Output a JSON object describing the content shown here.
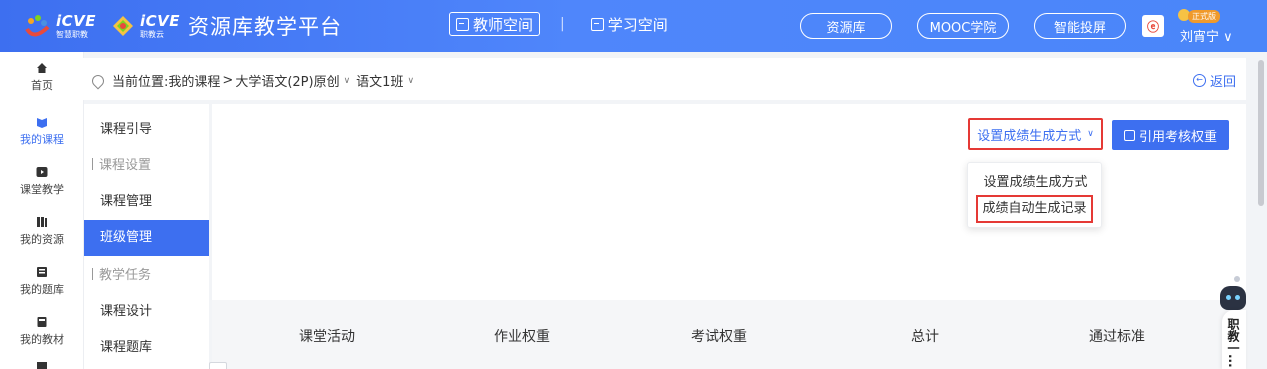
{
  "header": {
    "brand_primary": "iCVE",
    "brand_primary_sub": "智慧职教",
    "brand_secondary": "iCVE",
    "brand_secondary_sub": "职教云",
    "platform_name": "资源库教学平台",
    "tabs": [
      {
        "label": "教师空间",
        "active": true
      },
      {
        "label": "学习空间",
        "active": false
      }
    ],
    "separator": "|",
    "pills": [
      "资源库",
      "MOOC学院",
      "智能投屏"
    ],
    "user": {
      "badge": "正式版",
      "name": "刘宵宁 ∨"
    },
    "accent_color": "#3d6ff0"
  },
  "rail": {
    "items": [
      {
        "label": "首页",
        "icon": "home-icon",
        "active": false
      },
      {
        "label": "我的课程",
        "icon": "course-icon",
        "active": true
      },
      {
        "label": "课堂教学",
        "icon": "play-icon",
        "active": false
      },
      {
        "label": "我的资源",
        "icon": "books-icon",
        "active": false
      },
      {
        "label": "我的题库",
        "icon": "question-bank-icon",
        "active": false
      },
      {
        "label": "我的教材",
        "icon": "textbook-icon",
        "active": false
      }
    ]
  },
  "breadcrumb": {
    "prefix": "当前位置:",
    "path1": "我的课程",
    "sep": ">",
    "course": "大学语文(2P)原创",
    "chev": "∨",
    "klass": "语文1班",
    "back": "返回"
  },
  "course_sidebar": {
    "items": [
      {
        "label": "课程引导",
        "type": "item"
      },
      {
        "label": "课程设置",
        "type": "group"
      },
      {
        "label": "课程管理",
        "type": "item"
      },
      {
        "label": "班级管理",
        "type": "item",
        "active": true
      },
      {
        "label": "教学任务",
        "type": "group"
      },
      {
        "label": "课程设计",
        "type": "item"
      },
      {
        "label": "课程题库",
        "type": "item"
      }
    ]
  },
  "toolbar": {
    "grade_mode_label": "设置成绩生成方式",
    "chevron": "∨",
    "import_weight_label": "引用考核权重"
  },
  "dropdown": {
    "options": [
      "设置成绩生成方式",
      "成绩自动生成记录"
    ],
    "highlight_color": "#e53935"
  },
  "table": {
    "headers": [
      "课堂活动",
      "作业权重",
      "考试权重",
      "总计",
      "通过标准"
    ]
  },
  "assistant": {
    "label": "职教一..."
  }
}
